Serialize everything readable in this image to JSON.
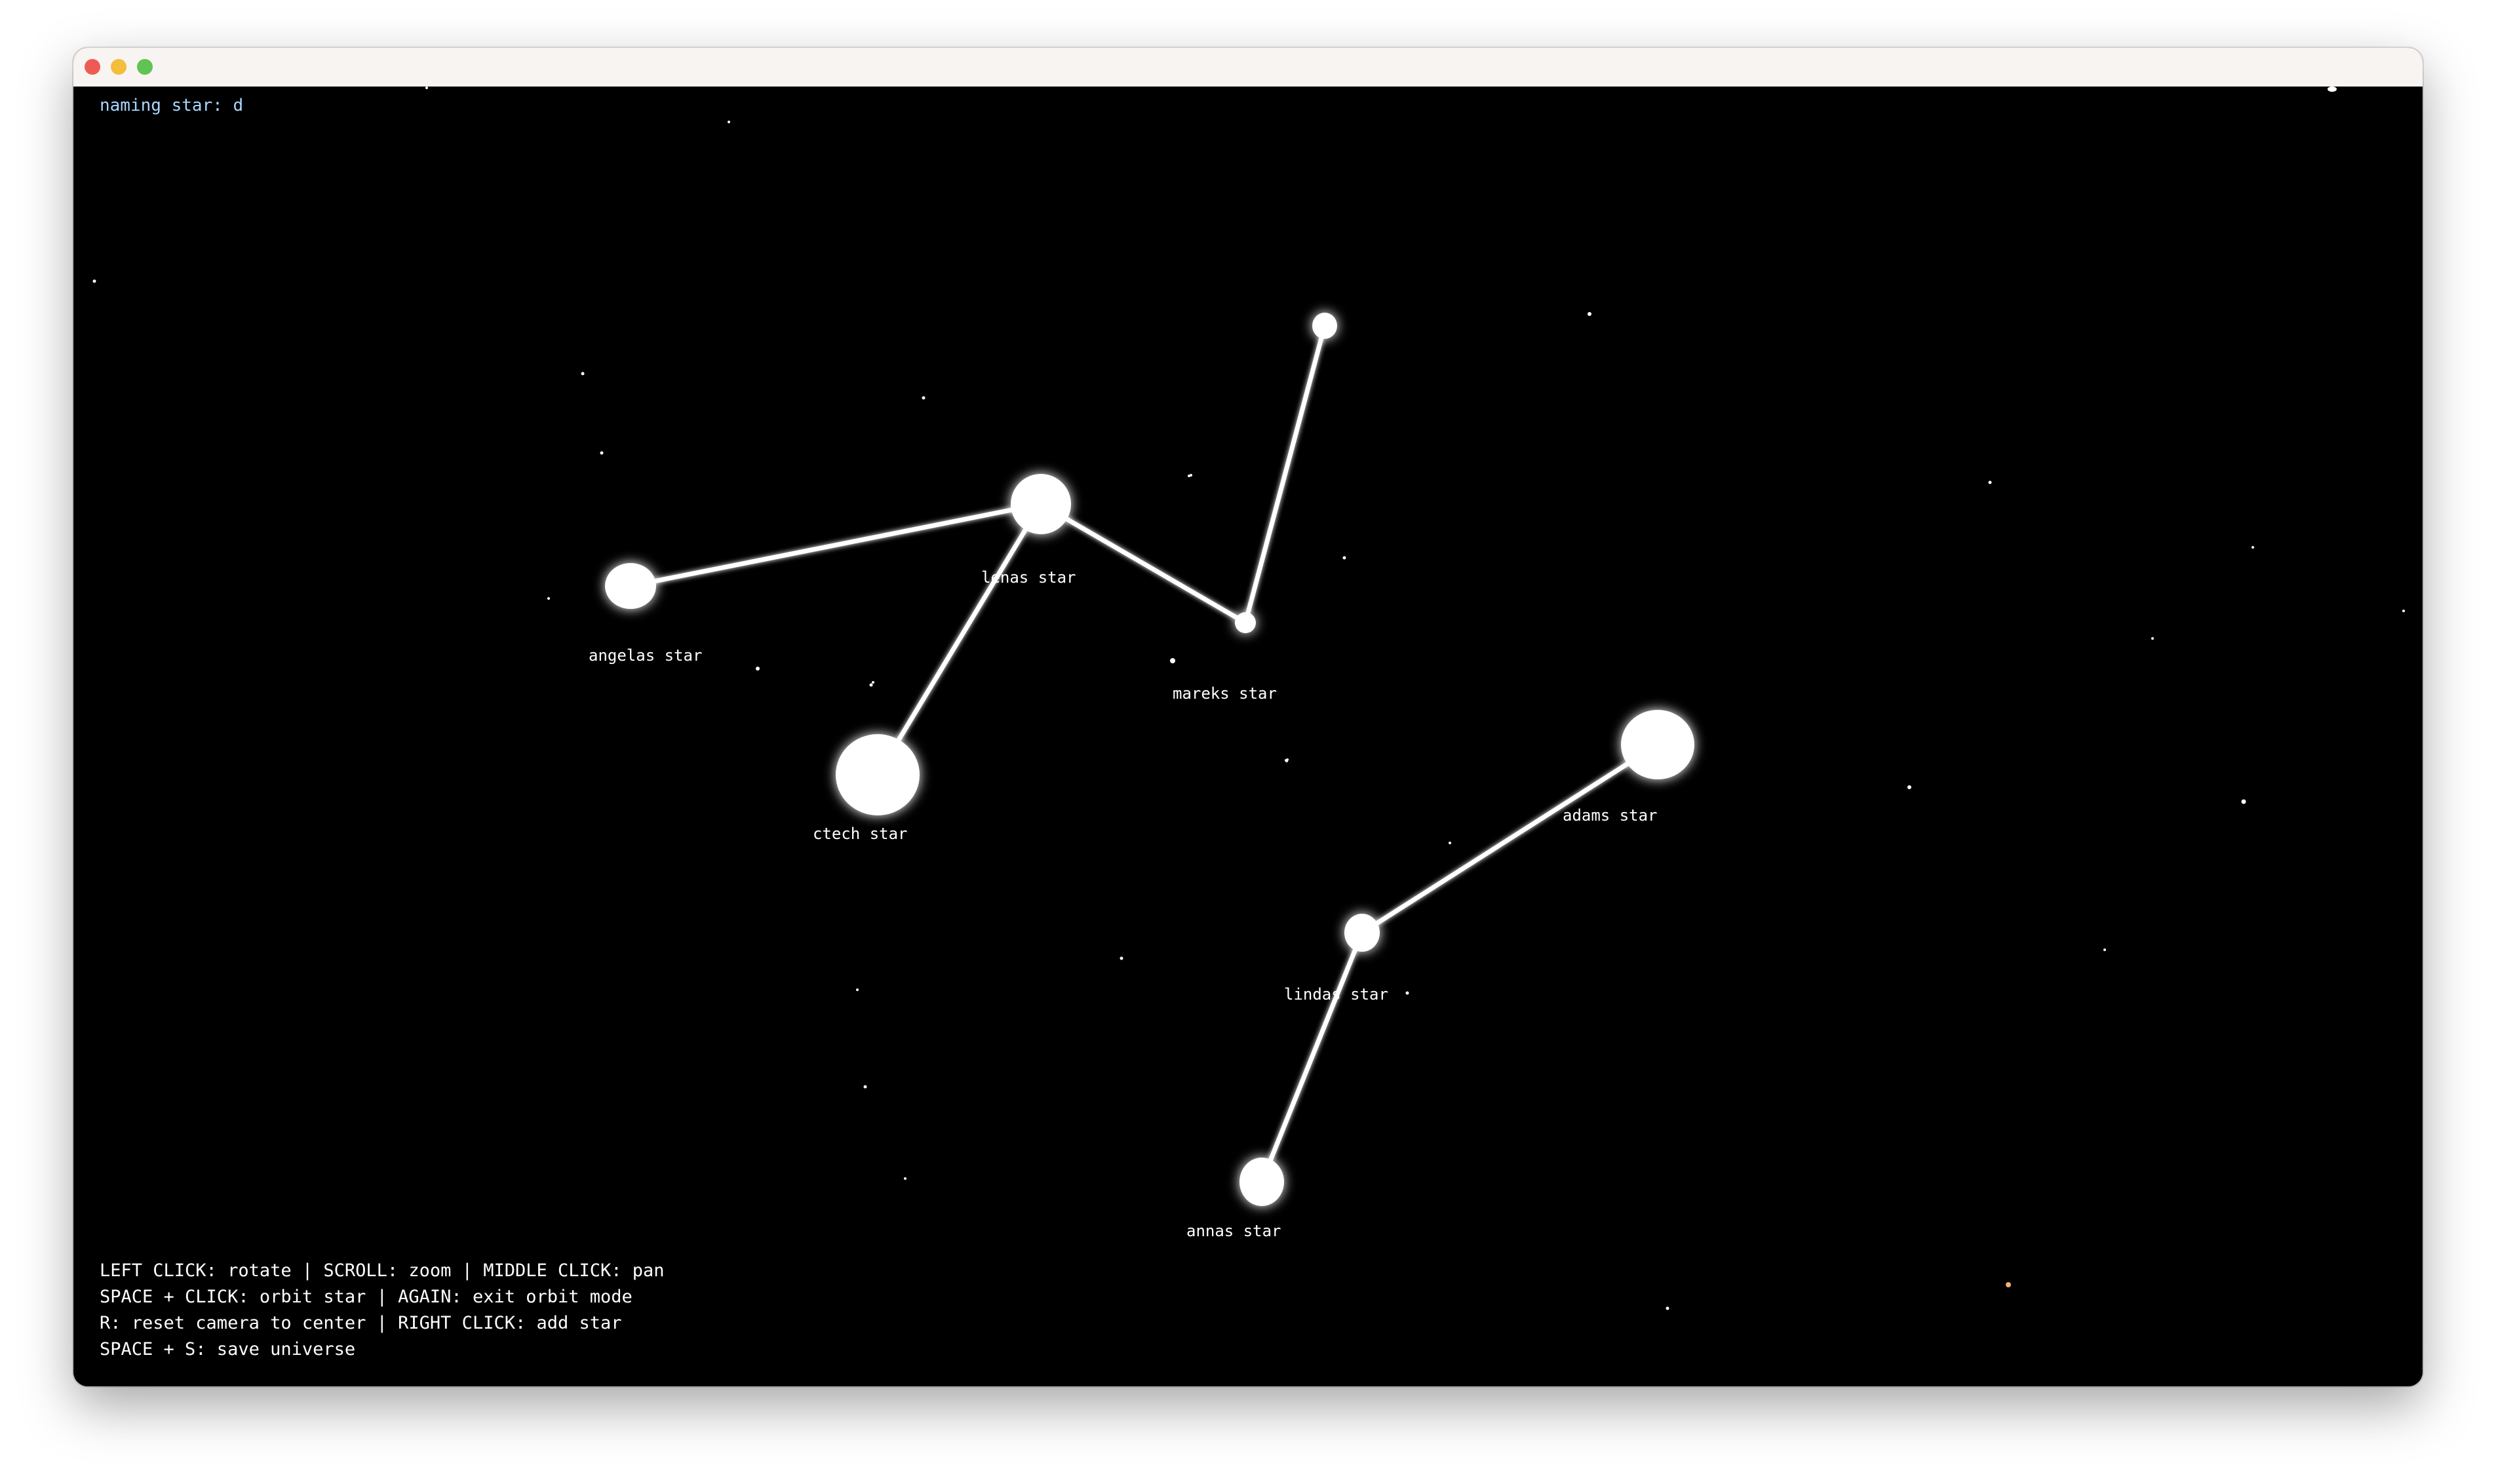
{
  "window": {
    "controls": [
      "close",
      "minimize",
      "zoom"
    ]
  },
  "status": {
    "naming_text": "naming star: d"
  },
  "help": {
    "lines": [
      "LEFT CLICK: rotate | SCROLL: zoom | MIDDLE CLICK: pan",
      "SPACE + CLICK: orbit star | AGAIN: exit orbit mode",
      "R: reset camera to center | RIGHT CLICK: add star",
      "SPACE + S: save universe"
    ]
  },
  "stars": [
    {
      "label": "angelas star"
    },
    {
      "label": "lenas star"
    },
    {
      "label": "ctech star"
    },
    {
      "label": "mareks star"
    },
    {
      "label": ""
    },
    {
      "label": "adams star"
    },
    {
      "label": "lindas star"
    },
    {
      "label": "annas star"
    }
  ],
  "colors": {
    "background": "#000000",
    "star": "#ffffff",
    "status_text": "#a9d6ff",
    "help_text": "#ffffff"
  }
}
